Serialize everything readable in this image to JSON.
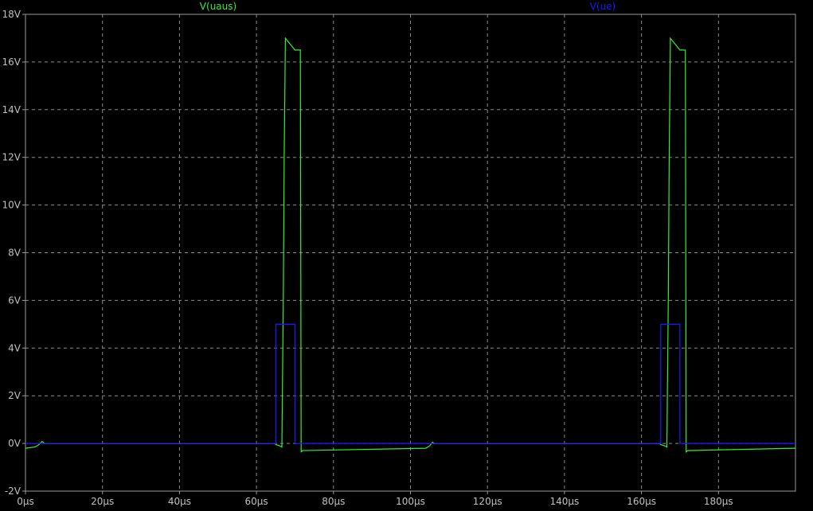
{
  "chart_data": {
    "type": "line",
    "title": "",
    "xlabel": "",
    "ylabel": "",
    "xlim": [
      0,
      200
    ],
    "ylim": [
      -2,
      18
    ],
    "grid": true,
    "legend_position": "top",
    "background_color": "#000000",
    "x_ticks": [
      0,
      20,
      40,
      60,
      80,
      100,
      120,
      140,
      160,
      180
    ],
    "x_tick_labels": [
      "0µs",
      "20µs",
      "40µs",
      "60µs",
      "80µs",
      "100µs",
      "120µs",
      "140µs",
      "160µs",
      "180µs"
    ],
    "y_ticks": [
      -2,
      0,
      2,
      4,
      6,
      8,
      10,
      12,
      14,
      16,
      18
    ],
    "y_tick_labels": [
      "-2V",
      "0V",
      "2V",
      "4V",
      "6V",
      "8V",
      "10V",
      "12V",
      "14V",
      "16V",
      "18V"
    ],
    "series": [
      {
        "name": "V(uaus)",
        "color": "#33ee33",
        "x": [
          0,
          2.5,
          3.5,
          4.3,
          5.0,
          64.8,
          65.0,
          66.0,
          66.6,
          67.0,
          67.2,
          67.5,
          70.0,
          71.4,
          71.6,
          72.0,
          104.0,
          105.0,
          105.7,
          106.2,
          106.8,
          164.8,
          165.0,
          166.0,
          166.6,
          167.0,
          167.2,
          167.5,
          170.0,
          171.4,
          171.6,
          172.0,
          200
        ],
        "y": [
          -0.2,
          -0.15,
          -0.05,
          0.08,
          0.0,
          0.0,
          -0.05,
          -0.1,
          -0.15,
          6.5,
          12.0,
          17.0,
          16.5,
          16.5,
          -0.35,
          -0.3,
          -0.2,
          -0.1,
          0.05,
          0.0,
          0.0,
          0.0,
          -0.05,
          -0.1,
          -0.15,
          6.5,
          12.0,
          17.0,
          16.5,
          16.5,
          -0.35,
          -0.3,
          -0.2
        ]
      },
      {
        "name": "V(ue)",
        "color": "#1a1aff",
        "x": [
          0,
          65.0,
          65.0,
          70.0,
          70.0,
          165.0,
          165.0,
          170.0,
          170.0,
          200
        ],
        "y": [
          0,
          0,
          5,
          5,
          0,
          0,
          5,
          5,
          0,
          0
        ]
      }
    ]
  }
}
